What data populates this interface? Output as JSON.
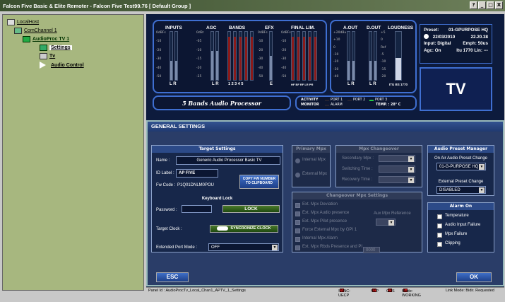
{
  "window": {
    "title": "Falcon Five Basic & Elite Remoter - Falcon Five Test99.76 [ Default Group ]",
    "btn_help": "?",
    "btn_min": "_",
    "btn_max": "□",
    "btn_close": "X"
  },
  "tree": {
    "root": "LocalHost",
    "channel": "ComChannel 1",
    "device": "AudioProc TV 1",
    "items": [
      "Settings",
      "Tv",
      "Audio Control"
    ]
  },
  "meters": {
    "inputs": "INPUTS",
    "agc": "AGC",
    "bands": "BANDS",
    "efx": "EFX",
    "final": "FINAL LIM.",
    "aout": "A.OUT",
    "dout": "D.OUT",
    "loudness": "LOUDNESS",
    "lr": "L R",
    "bands_nums": "1 2 3 4 5",
    "efx_e": "E",
    "final_foot": "HF BF RF LR PR",
    "loud_foot": "ITU BS 1770",
    "scale_in": [
      "0dBFs",
      "-10",
      "-20",
      "-30",
      "-40",
      "-50"
    ],
    "scale_agc": [
      "0dBr",
      "-05",
      "-10",
      "-15",
      "-20",
      "-25"
    ],
    "scale_aout": [
      "+20dBu",
      "+10",
      "0",
      "-10",
      "-20",
      "-30",
      "-40"
    ],
    "scale_loud": [
      "+5",
      "0",
      "Ref",
      "-5",
      "-10",
      "-15",
      "-20"
    ],
    "levels": {
      "in_l": 0.4,
      "in_r": 0.4,
      "agc_l": 0.6,
      "agc_r": 0.6,
      "bands": [
        0.9,
        0.9,
        0.9,
        0.9,
        0.9
      ],
      "efx": 0.5,
      "final": [
        0.9,
        0.9,
        0.9,
        0.9,
        0.9
      ],
      "aout_l": 0.4,
      "aout_r": 0.4,
      "dout_l": 0.4,
      "dout_r": 0.4,
      "loud": 0.45
    }
  },
  "processor": "5 Bands Audio Processor",
  "ports": {
    "activity": "ACTIVITY",
    "monitor": "MONITOR",
    "port1": "PORT 1",
    "port2": "PORT 2",
    "port3": "PORT 3",
    "alarm": "ALARM",
    "temp": "TEMP. : 28° C"
  },
  "info": {
    "preset_label": "Preset:",
    "preset": "01-GPURPOSE HQ",
    "date": "22/03/2010",
    "time": "22.20.38",
    "input": "Input: Digital",
    "emph": "Emph: 50us",
    "agc": "Agc: On",
    "itu": "Itu 1770 Lin: ---"
  },
  "tv": "TV",
  "general": {
    "title": "GENERAL SETTINGS"
  },
  "target": {
    "title": "Target Settings",
    "name_label": "Name :",
    "name": "Generic Audio Processor Basic TV",
    "id_label": "ID Label :",
    "id": "AP FIVE",
    "fw_label": "Fw Code :",
    "fw": "P1Q01DNLM0POU",
    "copy_btn": "COPY FW NUMBER TO CLIPBOARD",
    "kb_title": "Keyboard Lock",
    "pw_label": "Password :",
    "pw": "",
    "lock_btn": "LOCK",
    "clock_label": "Target Clock :",
    "sync_btn": "SYNCRONIZE CLOCK",
    "ext_label": "Extended Port Mode :",
    "ext": "OFF"
  },
  "primary": {
    "title": "Primary Mpx",
    "internal": "Internal Mpx",
    "external": "External Mpx"
  },
  "changeover": {
    "title": "Mpx Changeover",
    "secondary": "Secondary Mpx :",
    "switching": "Switching Time :",
    "recovery": "Recovery Time :"
  },
  "cosettings": {
    "title": "Changeover Mpx Settings",
    "items": [
      "Ext. Mpx Deviation",
      "Ext. Mpx Audio presence",
      "Ext. Mpx Pilot presence",
      "Force External Mpx by GPI 1",
      "Internal Mpx Alarm",
      "Ext. Mpx Rbds Presence and PI"
    ],
    "aux": "Aux Mpx Reference",
    "pi": "0000"
  },
  "preset_mgr": {
    "title": "Audio Preset Manager",
    "onair_label": "On Air Audio Preset Change",
    "onair": "01-G-PURPOSE HQ",
    "ext_label": "External Preset Change",
    "ext": "DISABLED"
  },
  "alarm": {
    "title": "Alarm On",
    "items": [
      "Temperature",
      "Audio Input Failure",
      "Mpx Failure",
      "Clipping"
    ]
  },
  "buttons": {
    "esc": "ESC",
    "ok": "OK"
  },
  "status": {
    "panel": "Panel Id : AudioProcTv_Local_Chan1_APTV_1_Settings",
    "sync": "SYNC: UECP",
    "ntp": "NTP",
    "gps": "GPS",
    "mode": "Mode: WORKING",
    "link": "Link Mode: Bidir. Requested"
  }
}
